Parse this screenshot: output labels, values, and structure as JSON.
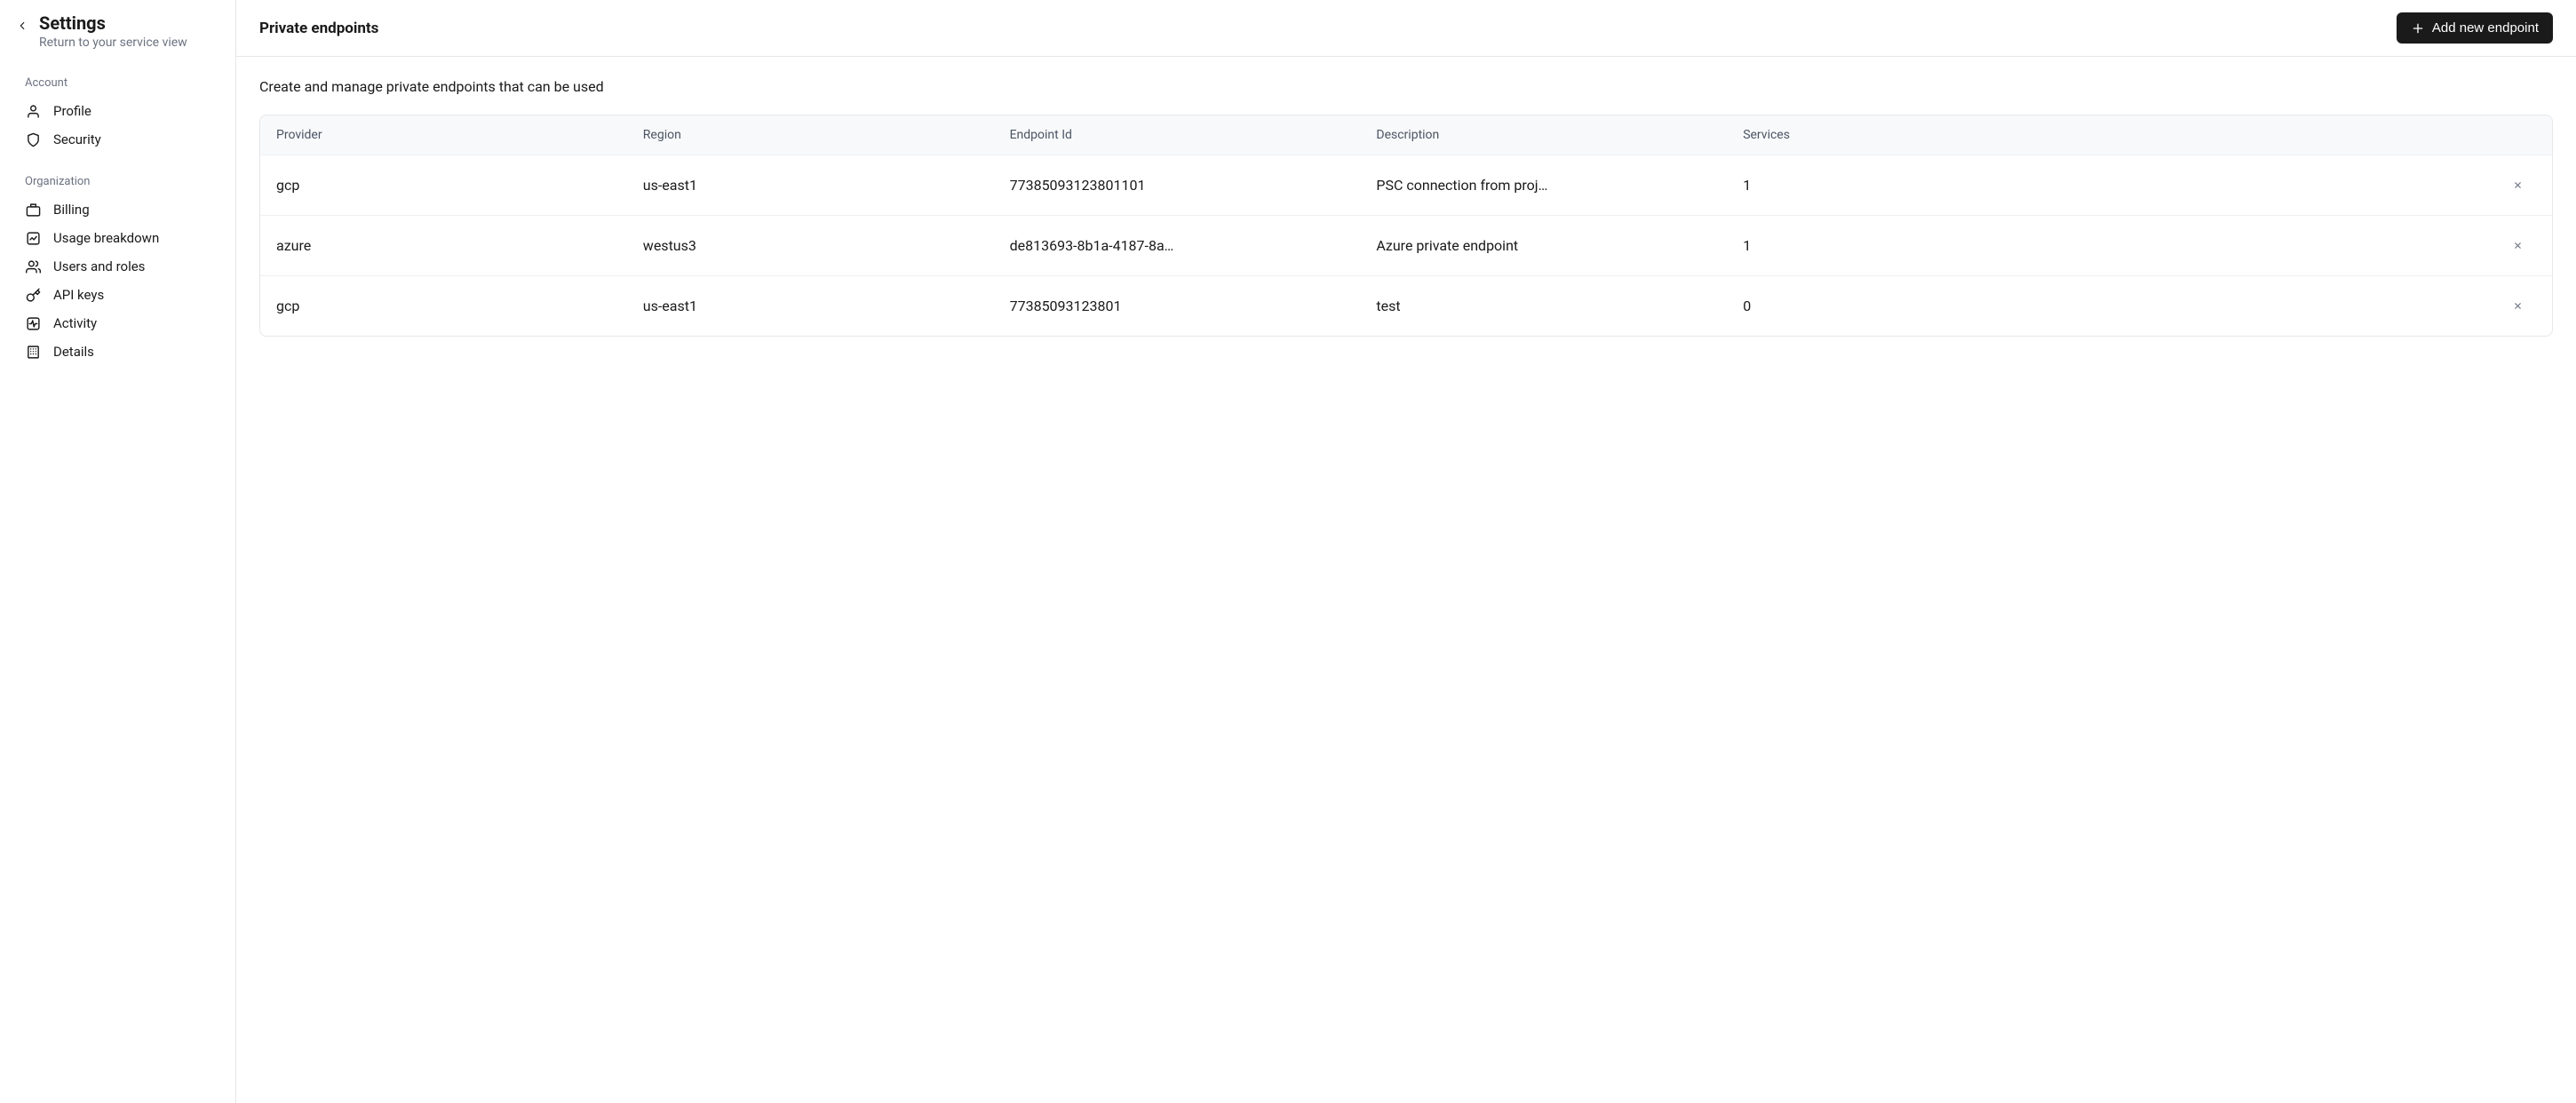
{
  "sidebar": {
    "title": "Settings",
    "subtitle": "Return to your service view",
    "sections": [
      {
        "label": "Account",
        "items": [
          {
            "label": "Profile"
          },
          {
            "label": "Security"
          }
        ]
      },
      {
        "label": "Organization",
        "items": [
          {
            "label": "Billing"
          },
          {
            "label": "Usage breakdown"
          },
          {
            "label": "Users and roles"
          },
          {
            "label": "API keys"
          },
          {
            "label": "Activity"
          },
          {
            "label": "Details"
          }
        ]
      }
    ]
  },
  "header": {
    "title": "Private endpoints",
    "add_button_label": "Add new endpoint"
  },
  "main": {
    "description": "Create and manage private endpoints that can be used",
    "table": {
      "columns": [
        "Provider",
        "Region",
        "Endpoint Id",
        "Description",
        "Services"
      ],
      "rows": [
        {
          "provider": "gcp",
          "region": "us-east1",
          "endpoint_id": "77385093123801101",
          "description": "PSC connection from proj…",
          "services": "1"
        },
        {
          "provider": "azure",
          "region": "westus3",
          "endpoint_id": "de813693-8b1a-4187-8a…",
          "description": "Azure private endpoint",
          "services": "1"
        },
        {
          "provider": "gcp",
          "region": "us-east1",
          "endpoint_id": "77385093123801",
          "description": "test",
          "services": "0"
        }
      ]
    }
  }
}
